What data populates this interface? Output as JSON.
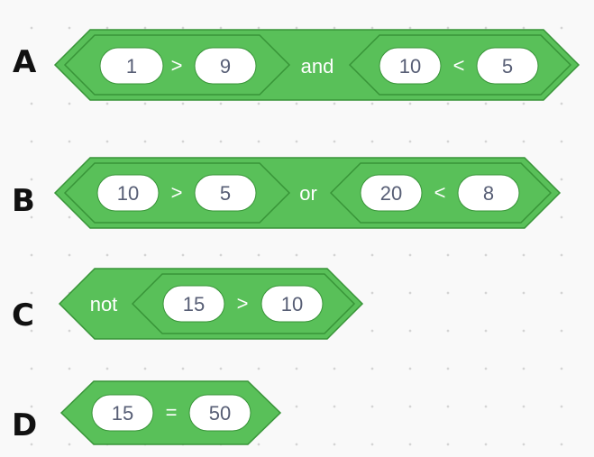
{
  "rows": [
    {
      "letter": "A",
      "left": {
        "a": "1",
        "op": ">",
        "b": "9"
      },
      "joiner": "and",
      "right": {
        "a": "10",
        "op": "<",
        "b": "5"
      }
    },
    {
      "letter": "B",
      "left": {
        "a": "10",
        "op": ">",
        "b": "5"
      },
      "joiner": "or",
      "right": {
        "a": "20",
        "op": "<",
        "b": "8"
      }
    },
    {
      "letter": "C",
      "prefix": "not",
      "inner": {
        "a": "15",
        "op": ">",
        "b": "10"
      }
    },
    {
      "letter": "D",
      "inner": {
        "a": "15",
        "op": "=",
        "b": "50"
      }
    }
  ],
  "colors": {
    "block_fill": "#59c059",
    "block_border": "#389438",
    "pill_fill": "#ffffff",
    "number_text": "#575e75",
    "operator_text": "#ffffff",
    "canvas": "#f9f9f9"
  }
}
